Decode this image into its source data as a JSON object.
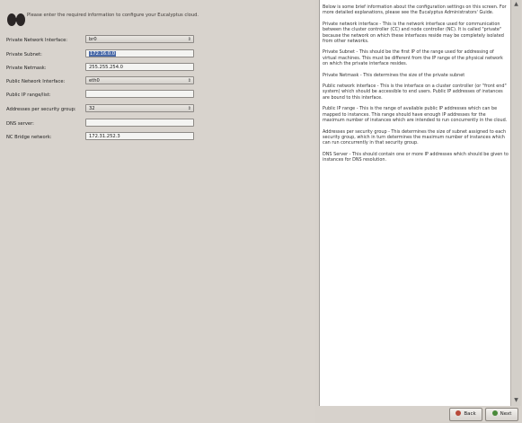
{
  "intro": "Please enter the required information to configure your Eucalyptus cloud.",
  "form": {
    "rows": [
      {
        "label": "Private Network Interface:",
        "value": "br0",
        "kind": "select"
      },
      {
        "label": "Private Subnet:",
        "value": "172.16.0.0",
        "kind": "text-selected"
      },
      {
        "label": "Private Netmask:",
        "value": "255.255.254.0",
        "kind": "text"
      },
      {
        "label": "Public Network Interface:",
        "value": "eth0",
        "kind": "select"
      },
      {
        "label": "Public IP range/list:",
        "value": "",
        "kind": "text"
      },
      {
        "label": "Addresses per security group:",
        "value": "32",
        "kind": "select"
      },
      {
        "label": "DNS server:",
        "value": "",
        "kind": "text"
      },
      {
        "label": "NC Bridge network:",
        "value": "172.31.252.3",
        "kind": "text"
      }
    ]
  },
  "help": {
    "paragraphs": [
      "Below is some brief information about the configuration settings on this screen. For more detailed explanations, please see the Eucalyptus Administrators' Guide.",
      "Private network interface - This is the network interface used for communication between the cluster controller (CC) and node controller (NC). It is called \"private\" because the network on which these interfaces reside may be completely isolated from other networks.",
      "Private Subnet - This should be the first IP of the range used for addressing of virtual machines. This must be different from the IP range of the physical network on which the private interface resides.",
      "Private Netmask - This determines the size of the private subnet",
      "Public network interface - This is the interface on a cluster controller (or \"front end\" system) which should be accessible to end users. Public IP addresses of instances are bound to this interface.",
      "Public IP range - This is the range of available public IP addresses which can be mapped to instances. This range should have enough IP addresses for the maximum number of instances which are intended to run concurrently in the cloud.",
      "Addresses per security group - This determines the size of subnet assigned to each security group, which in turn determines the maximum number of instances which can run concurrently in that security group.",
      "DNS Server - This should contain one or more IP addresses which should be given to instances for DNS resolution."
    ]
  },
  "buttons": {
    "back": "Back",
    "next": "Next"
  }
}
